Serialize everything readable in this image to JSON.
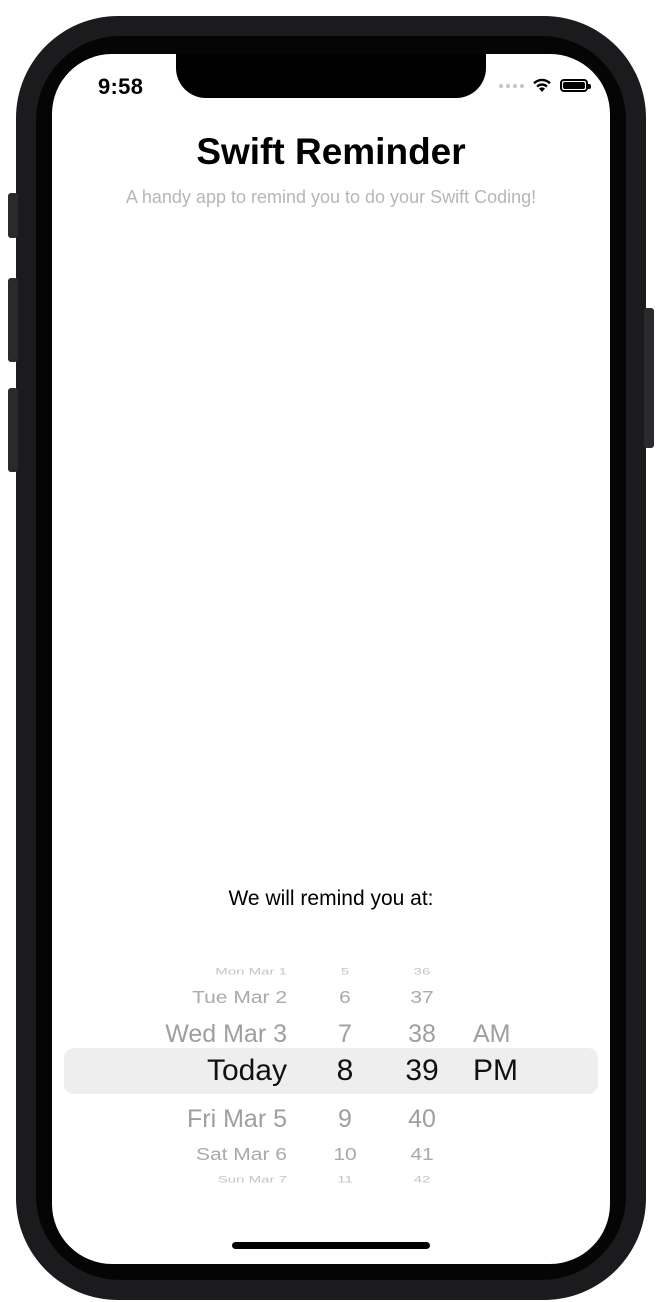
{
  "status_bar": {
    "time": "9:58"
  },
  "app": {
    "title": "Swift Reminder",
    "subtitle": "A handy app to remind you to do your Swift Coding!",
    "remind_label": "We will remind you at:"
  },
  "picker": {
    "rows": [
      {
        "date": "Mon Mar 1",
        "hour": "5",
        "minute": "36",
        "ampm": ""
      },
      {
        "date": "Tue Mar 2",
        "hour": "6",
        "minute": "37",
        "ampm": ""
      },
      {
        "date": "Wed Mar 3",
        "hour": "7",
        "minute": "38",
        "ampm": "AM"
      },
      {
        "date": "Today",
        "hour": "8",
        "minute": "39",
        "ampm": "PM"
      },
      {
        "date": "Fri Mar 5",
        "hour": "9",
        "minute": "40",
        "ampm": ""
      },
      {
        "date": "Sat Mar 6",
        "hour": "10",
        "minute": "41",
        "ampm": ""
      },
      {
        "date": "Sun Mar 7",
        "hour": "11",
        "minute": "42",
        "ampm": ""
      }
    ],
    "selected_index": 3
  },
  "colors": {
    "frame": "#1b1b1d",
    "title": "#000000",
    "subtitle": "#b6b6bb",
    "picker_highlight": "#eeeeef"
  }
}
